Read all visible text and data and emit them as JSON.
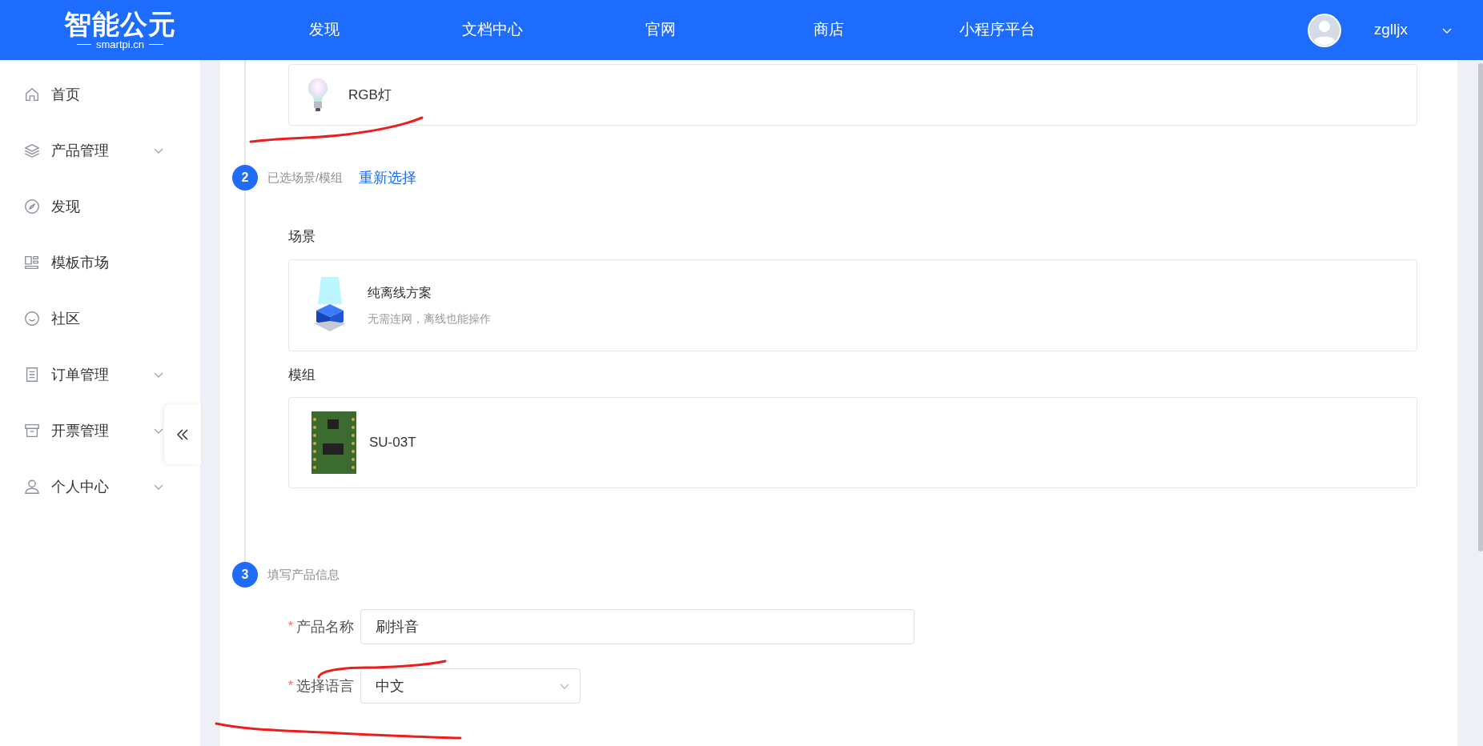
{
  "header": {
    "logo": {
      "title": "智能公元",
      "subtitle": "smartpi.cn"
    },
    "nav": [
      {
        "label": "发现"
      },
      {
        "label": "文档中心"
      },
      {
        "label": "官网"
      },
      {
        "label": "商店"
      },
      {
        "label": "小程序平台"
      }
    ],
    "user": {
      "name": "zglljx"
    }
  },
  "sidebar": {
    "items": [
      {
        "label": "首页",
        "expandable": false
      },
      {
        "label": "产品管理",
        "expandable": true
      },
      {
        "label": "发现",
        "expandable": false
      },
      {
        "label": "模板市场",
        "expandable": false
      },
      {
        "label": "社区",
        "expandable": false
      },
      {
        "label": "订单管理",
        "expandable": true
      },
      {
        "label": "开票管理",
        "expandable": true
      },
      {
        "label": "个人中心",
        "expandable": true
      }
    ]
  },
  "category_card": {
    "name": "RGB灯"
  },
  "step2": {
    "number": "2",
    "title": "已选场景/模组",
    "link": "重新选择",
    "scene_label": "场景",
    "scene": {
      "name": "纯离线方案",
      "description": "无需连网，离线也能操作"
    },
    "module_label": "模组",
    "module": {
      "name": "SU-03T"
    }
  },
  "step3": {
    "number": "3",
    "title": "填写产品信息",
    "fields": [
      {
        "kind": "input",
        "required_mark": "*",
        "label": "产品名称",
        "value": "刷抖音"
      },
      {
        "kind": "select",
        "required_mark": "*",
        "label": "选择语言",
        "value": "中文"
      }
    ]
  }
}
